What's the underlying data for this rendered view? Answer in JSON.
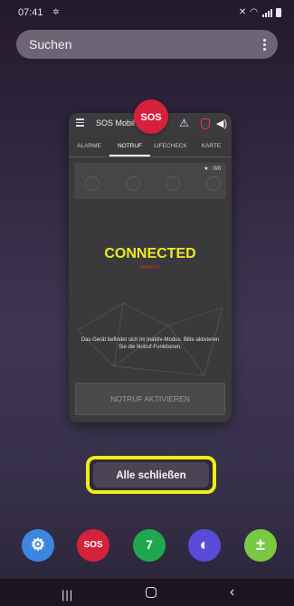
{
  "status_bar": {
    "time": "07:41",
    "left_icon": "notification-icon",
    "right_icons": [
      "mute-icon",
      "wifi-icon",
      "signal-icon",
      "battery-icon"
    ]
  },
  "search": {
    "label": "Suchen",
    "menu_icon": "more-vert-icon"
  },
  "recent_app": {
    "icon_label": "SOS",
    "title": "SOS Mobil",
    "tabs": [
      "ALARME",
      "NOTRUF",
      "LIFECHECK",
      "KARTE"
    ],
    "active_tab": "NOTRUF",
    "stats": "★ : 0/0",
    "status_headline": "CONNECTED",
    "status_sub": "INAKTIV",
    "message": "Das Gerät befindet sich im Inaktiv-Modus. Bitte aktivieren Sie die Notruf-Funktionen.",
    "activate_label": "NOTRUF AKTIVIEREN",
    "colors": {
      "headline": "#eeea2a",
      "sub": "#d23434",
      "brand": "#d6213c"
    }
  },
  "close_all": {
    "label": "Alle schließen",
    "highlight_color": "#f0ee0e"
  },
  "dock": {
    "apps": [
      {
        "name": "settings-app",
        "glyph": "⚙",
        "color": "#3d86e0"
      },
      {
        "name": "sos-app",
        "glyph": "SOS",
        "color": "#d6213c"
      },
      {
        "name": "calendar-app",
        "glyph": "7",
        "color": "#1fa84f"
      },
      {
        "name": "internet-app",
        "glyph": "◐",
        "color": "#5a4ad8"
      },
      {
        "name": "calculator-app",
        "glyph": "±",
        "color": "#7ac943"
      }
    ]
  },
  "nav": {
    "recents": "|||",
    "back": "‹"
  }
}
